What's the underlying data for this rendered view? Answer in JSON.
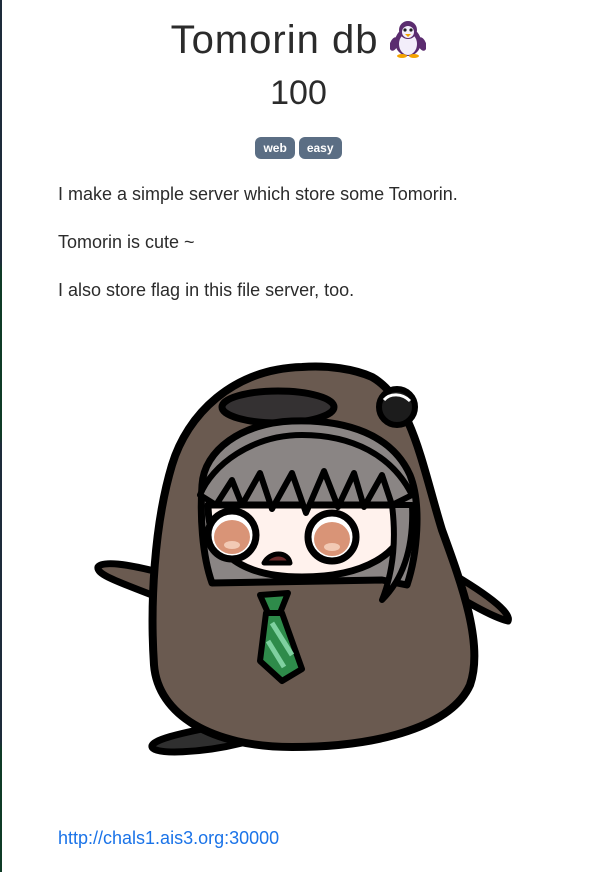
{
  "challenge": {
    "title": "Tomorin db",
    "title_icon": "penguin-icon",
    "points": "100",
    "tags": [
      "web",
      "easy"
    ],
    "description": [
      "I make a simple server which store some Tomorin.",
      "Tomorin is cute ~",
      "I also store flag in this file server, too."
    ],
    "link": "http://chals1.ais3.org:30000"
  },
  "colors": {
    "tag_background": "#5b6e84",
    "link": "#1a73e8",
    "penguin_body": "#6a5a50",
    "hair": "#8a8584",
    "tie": "#2e8b4a"
  }
}
